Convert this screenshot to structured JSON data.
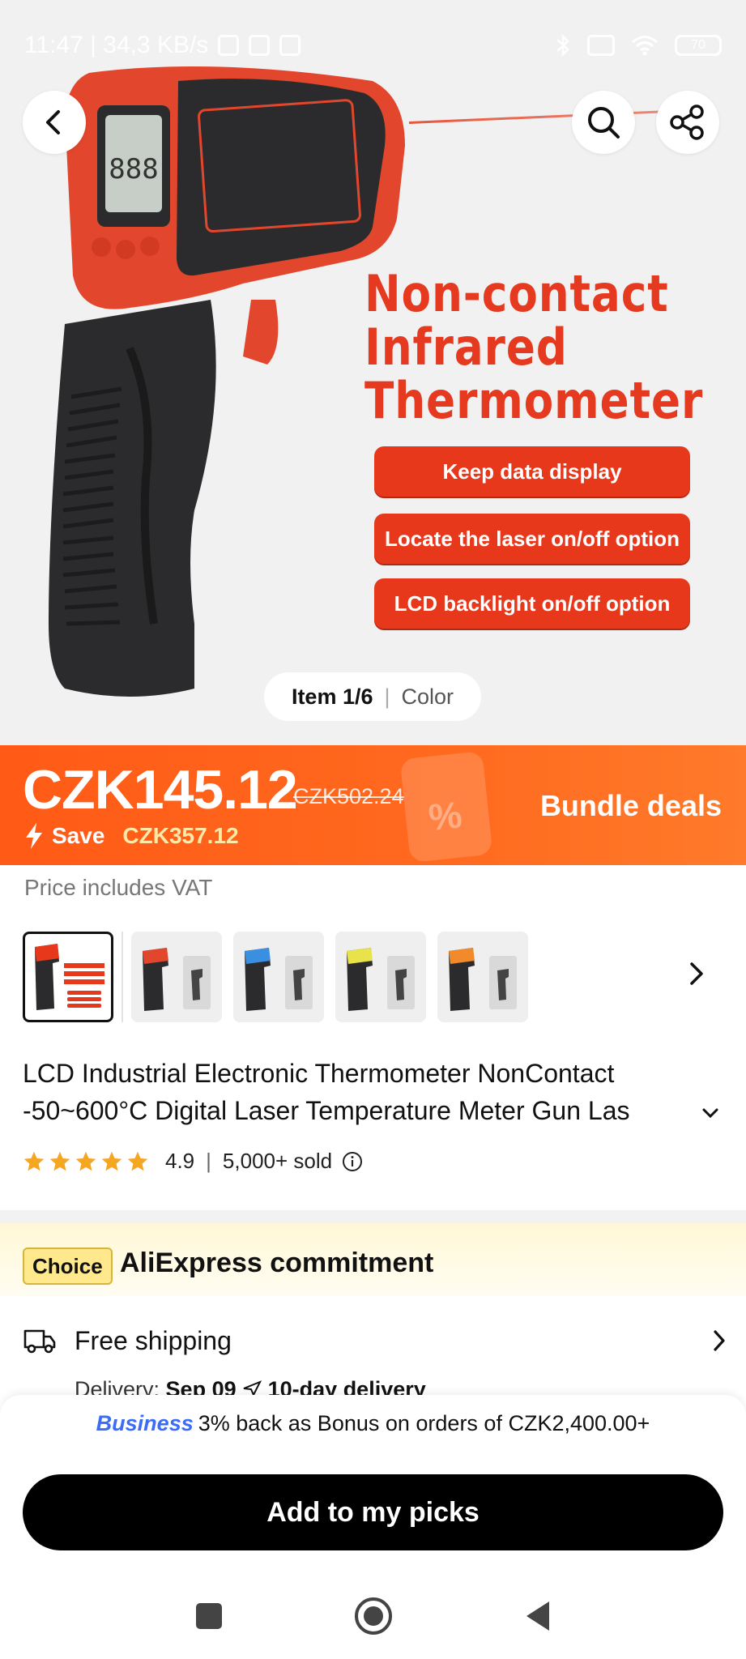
{
  "status_bar": {
    "time_speed": "11:47 | 34,3 KB/s",
    "battery": "70"
  },
  "hero": {
    "title_line1": "Non-contact",
    "title_line2": "Infrared",
    "title_line3": "Thermometer",
    "features": [
      "Keep data display",
      "Locate the laser on/off option",
      "LCD backlight on/off option"
    ],
    "item_counter": "Item 1/6",
    "color_label": "Color",
    "device_lcd": "888"
  },
  "price": {
    "current": "CZK145.12",
    "original": "CZK502.24",
    "save_label": "Save",
    "save_amount": "CZK357.12",
    "bundle_label": "Bundle deals",
    "vat_note": "Price includes VAT",
    "tag_symbol": "%"
  },
  "thumbnails": [
    {
      "name": "main",
      "accent": "#e8381c",
      "active": true
    },
    {
      "name": "red",
      "accent": "#e2472d"
    },
    {
      "name": "blue",
      "accent": "#3b8fe0"
    },
    {
      "name": "yellow",
      "accent": "#e8e34a"
    },
    {
      "name": "orange",
      "accent": "#f08a2a"
    }
  ],
  "product": {
    "title_line1": "LCD Industrial Electronic Thermometer NonContact",
    "title_line2": "-50~600°C Digital Laser Temperature Meter Gun Las",
    "rating": "4.9",
    "sold": "5,000+ sold",
    "star_count": 5
  },
  "choice": {
    "badge": "Choice",
    "commitment": "AliExpress commitment",
    "shipping": "Free shipping",
    "delivery_prefix": "Delivery:",
    "delivery_date": "Sep 09",
    "delivery_speed": "10-day delivery"
  },
  "bottom": {
    "business_label": "Business",
    "bonus_text": "3% back as Bonus on orders of CZK2,400.00+",
    "add_button": "Add to my picks"
  },
  "colors": {
    "brand_orange": "#ff5a16",
    "hero_red": "#e53a1f",
    "business_blue": "#3b6cf6",
    "star_orange": "#f5a623"
  }
}
